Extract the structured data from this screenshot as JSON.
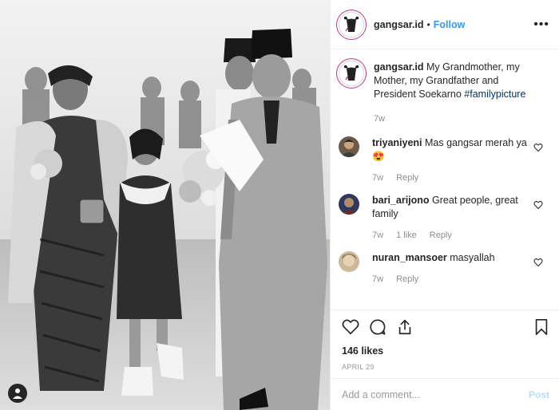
{
  "post": {
    "owner": "gangsar.id",
    "follow_label": "Follow",
    "separator": "•",
    "more_label": "•••",
    "photo_alt": "black and white family photo"
  },
  "caption": {
    "username": "gangsar.id",
    "text": "My Grandmother, my Mother, my Grandfather and President Soekarno",
    "hashtag": "#familypicture",
    "time": "7w"
  },
  "comments": [
    {
      "username": "triyaniyeni",
      "text": "Mas gangsar merah ya",
      "emoji": "😍",
      "time": "7w",
      "likes": "",
      "reply": "Reply"
    },
    {
      "username": "bari_arijono",
      "text": "Great people, great family",
      "emoji": "",
      "time": "7w",
      "likes": "1 like",
      "reply": "Reply"
    },
    {
      "username": "nuran_mansoer",
      "text": "masyallah",
      "emoji": "",
      "time": "7w",
      "likes": "",
      "reply": "Reply"
    }
  ],
  "actions": {
    "likes_text": "146 likes",
    "date": "APRIL 29"
  },
  "composer": {
    "placeholder": "Add a comment...",
    "post_label": "Post"
  },
  "colors": {
    "link": "#3897f0",
    "hashtag": "#003569",
    "muted": "#8e8e8e",
    "post_disabled": "#b2dffc"
  }
}
